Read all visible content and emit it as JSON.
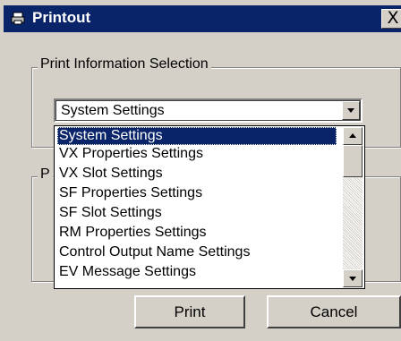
{
  "window": {
    "title": "Printout",
    "close_glyph": "X",
    "title_icon": "printer-icon"
  },
  "group_print_info": {
    "legend": "Print Information Selection"
  },
  "group_second": {
    "legend": "P"
  },
  "combo": {
    "value": "System Settings",
    "arrow_icon": "chevron-down-icon"
  },
  "dropdown": {
    "items": [
      "System Settings",
      "VX Properties Settings",
      "VX Slot Settings",
      "SF Properties Settings",
      "SF Slot Settings",
      "RM Properties Settings",
      "Control Output Name Settings",
      "EV Message Settings"
    ],
    "selected_index": 0,
    "scroll_up_icon": "arrow-up-icon",
    "scroll_down_icon": "arrow-down-icon"
  },
  "buttons": {
    "print_label": "Print",
    "cancel_label": "Cancel"
  },
  "colors": {
    "title_bar": "#0a246a",
    "selection": "#0a246a",
    "face": "#d4d0c8"
  }
}
